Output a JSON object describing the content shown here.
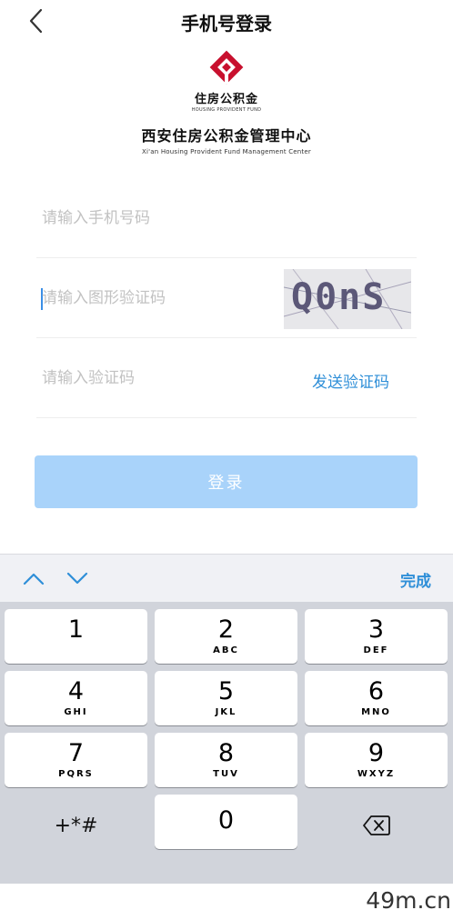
{
  "nav": {
    "title": "手机号登录",
    "back_icon": "chevron-left-icon"
  },
  "logo": {
    "cn": "住房公积金",
    "en": "HOUSING PROVIDENT FUND",
    "org_cn": "西安住房公积金管理中心",
    "org_en": "Xi'an Housing Provident Fund Management Center",
    "brand_color": "#c8102e"
  },
  "form": {
    "phone_placeholder": "请输入手机号码",
    "captcha_placeholder": "请输入图形验证码",
    "captcha_text": "Q0nS",
    "sms_placeholder": "请输入验证码",
    "send_code_label": "发送验证码",
    "login_label": "登录"
  },
  "keyboard": {
    "done_label": "完成",
    "up_icon": "chevron-up-icon",
    "down_icon": "chevron-down-icon",
    "keys": [
      {
        "num": "1",
        "letters": ""
      },
      {
        "num": "2",
        "letters": "ABC"
      },
      {
        "num": "3",
        "letters": "DEF"
      },
      {
        "num": "4",
        "letters": "GHI"
      },
      {
        "num": "5",
        "letters": "JKL"
      },
      {
        "num": "6",
        "letters": "MNO"
      },
      {
        "num": "7",
        "letters": "PQRS"
      },
      {
        "num": "8",
        "letters": "TUV"
      },
      {
        "num": "9",
        "letters": "WXYZ"
      }
    ],
    "zero": "0",
    "symbols": "+*#",
    "delete_icon": "backspace-icon"
  },
  "watermark": "49m.cn",
  "colors": {
    "accent": "#2f8fd8",
    "button_disabled": "#a9d3fa"
  }
}
